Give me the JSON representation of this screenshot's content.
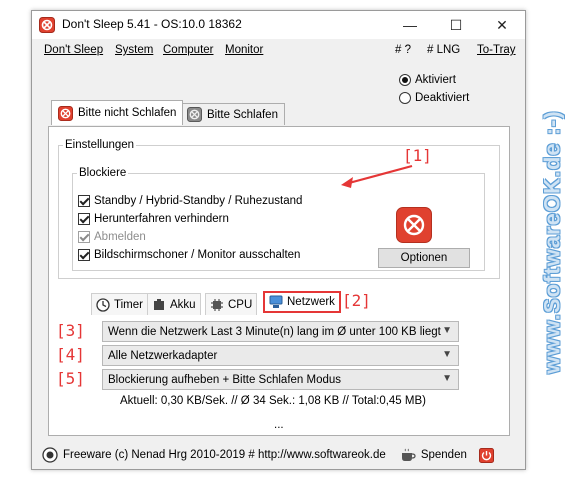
{
  "window": {
    "title": "Don't Sleep 5.41 - OS:10.0 18362",
    "minimize": "—",
    "maximize": "☐",
    "close": "✕"
  },
  "menu": {
    "dont_sleep": "Don't Sleep",
    "system": "System",
    "computer": "Computer",
    "monitor": "Monitor",
    "help": "# ?",
    "lng": "# LNG",
    "to_tray": "To-Tray"
  },
  "mode": {
    "activated": "Aktiviert",
    "deactivated": "Deaktiviert",
    "selected": "Aktiviert"
  },
  "tabs": {
    "no_sleep": "Bitte nicht Schlafen",
    "sleep": "Bitte Schlafen"
  },
  "settings": {
    "legend": "Einstellungen",
    "block_legend": "Blockiere",
    "standby": "Standby / Hybrid-Standby / Ruhezustand",
    "shutdown": "Herunterfahren verhindern",
    "logoff": "Abmelden",
    "screensaver": "Bildschirmschoner / Monitor ausschalten",
    "options_button": "Optionen"
  },
  "subtabs": {
    "timer": "Timer",
    "battery": "Akku",
    "cpu": "CPU",
    "network": "Netzwerk"
  },
  "network": {
    "condition": "Wenn die Netzwerk Last 3 Minute(n) lang im Ø unter 100 KB liegt",
    "adapter": "Alle Netzwerkadapter",
    "action": "Blockierung aufheben + Bitte Schlafen Modus",
    "status": "Aktuell: 0,30 KB/Sek. // Ø 34 Sek.: 1,08 KB //  Total:0,45 MB)",
    "ellipsis": "..."
  },
  "markers": {
    "m1": "[1]",
    "m2": "[2]",
    "m3": "[3]",
    "m4": "[4]",
    "m5": "[5]"
  },
  "footer": {
    "text": "Freeware (c) Nenad Hrg 2010-2019 # http://www.softwareok.de",
    "donate": "Spenden"
  },
  "watermark": "www.SoftwareOK.de :-)",
  "colors": {
    "accent_red": "#e53636",
    "stop_red": "#e0412f",
    "window_bg": "#f0f0f0"
  }
}
